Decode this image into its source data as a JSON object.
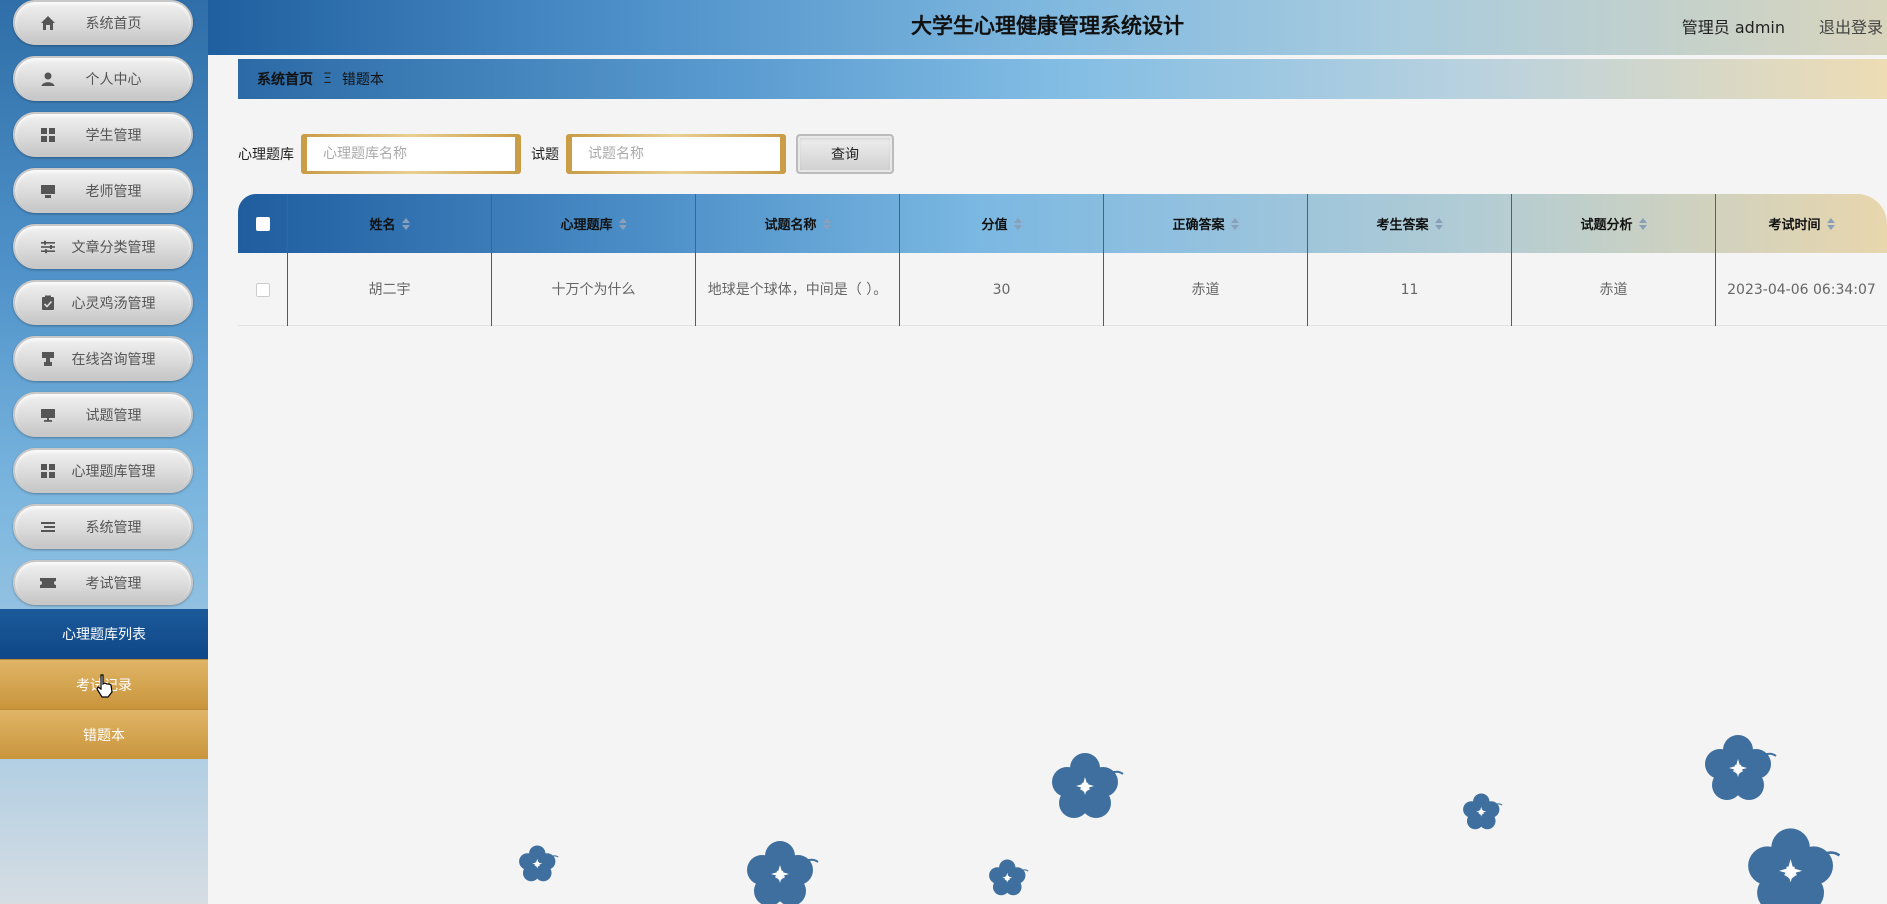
{
  "header": {
    "title": "大学生心理健康管理系统设计",
    "user": "管理员 admin",
    "logout": "退出登录"
  },
  "sidebar": {
    "items": [
      {
        "label": "系统首页",
        "icon": "home-icon"
      },
      {
        "label": "个人中心",
        "icon": "user-icon"
      },
      {
        "label": "学生管理",
        "icon": "grid-icon"
      },
      {
        "label": "老师管理",
        "icon": "chalkboard-icon"
      },
      {
        "label": "文章分类管理",
        "icon": "sliders-icon"
      },
      {
        "label": "心灵鸡汤管理",
        "icon": "clipboard-check-icon"
      },
      {
        "label": "在线咨询管理",
        "icon": "stamp-icon"
      },
      {
        "label": "试题管理",
        "icon": "monitor-icon"
      },
      {
        "label": "心理题库管理",
        "icon": "grid-icon"
      },
      {
        "label": "系统管理",
        "icon": "list-icon"
      },
      {
        "label": "考试管理",
        "icon": "ticket-icon"
      }
    ],
    "sub_items": [
      {
        "label": "心理题库列表"
      },
      {
        "label": "考试记录"
      },
      {
        "label": "错题本"
      }
    ]
  },
  "breadcrumb": {
    "home": "系统首页",
    "separator": "Ξ",
    "current": "错题本"
  },
  "search": {
    "bank_label": "心理题库",
    "bank_placeholder": "心理题库名称",
    "question_label": "试题",
    "question_placeholder": "试题名称",
    "button": "查询"
  },
  "table": {
    "columns": [
      "姓名",
      "心理题库",
      "试题名称",
      "分值",
      "正确答案",
      "考生答案",
      "试题分析",
      "考试时间"
    ],
    "rows": [
      {
        "name": "胡二宇",
        "bank": "十万个为什么",
        "question": "地球是个球体，中间是（ ）。",
        "score": "30",
        "correct": "赤道",
        "answer": "11",
        "analysis": "赤道",
        "time": "2023-04-06 06:34:07"
      }
    ]
  },
  "colors": {
    "accent_blue": "#1f5f9f",
    "gold": "#c9953c",
    "flower": "#3f6f9e"
  }
}
